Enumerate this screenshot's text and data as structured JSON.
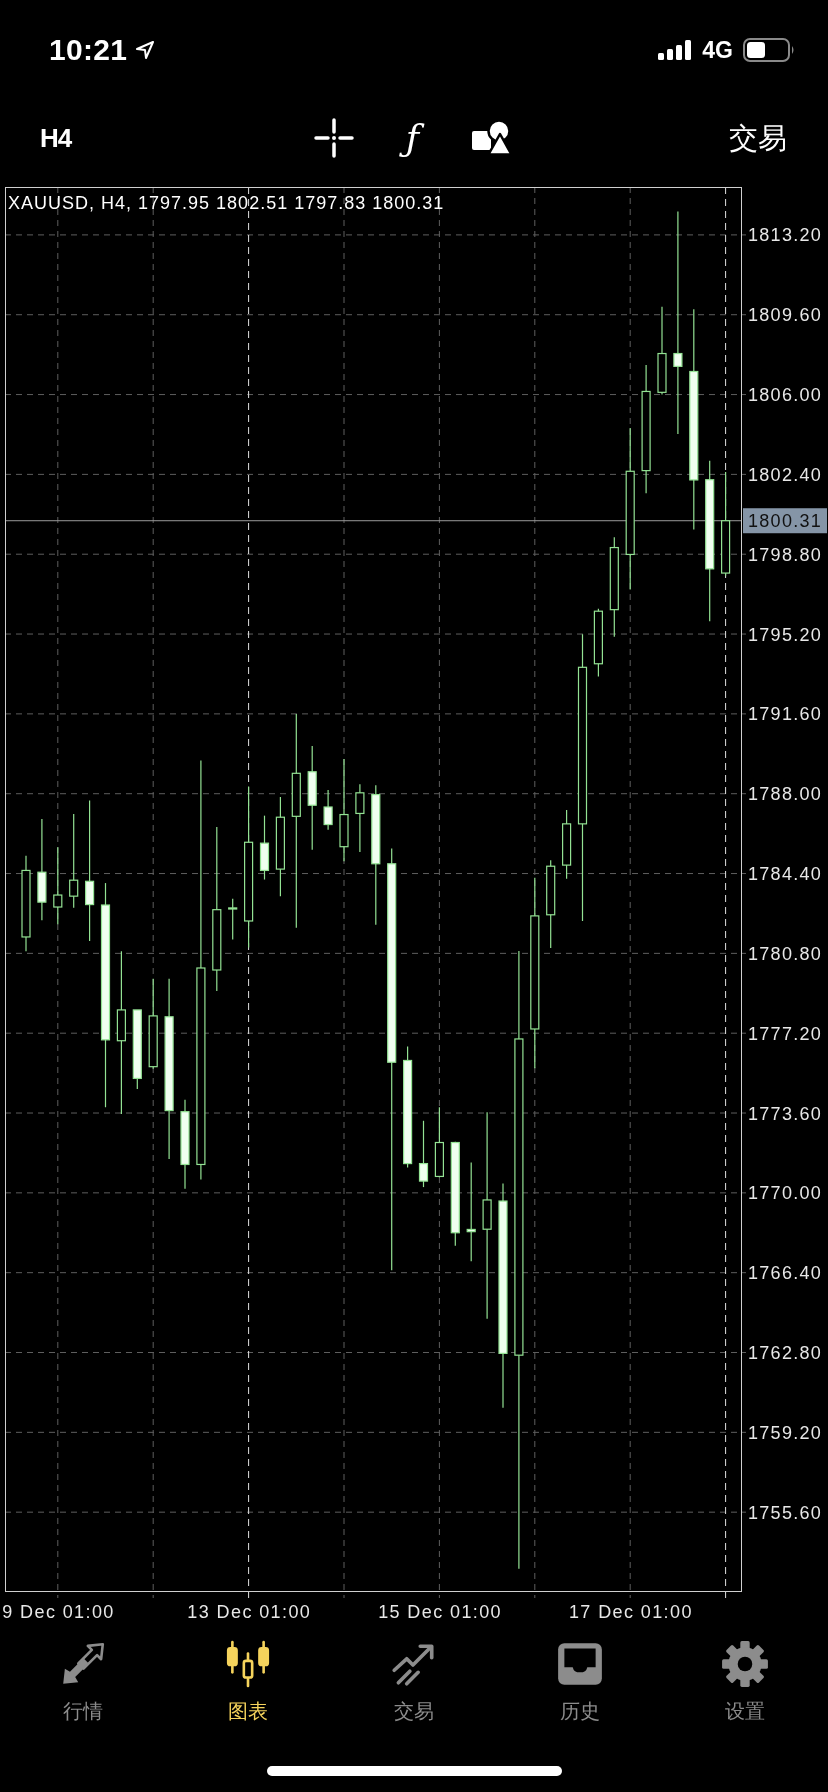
{
  "status_bar": {
    "time": "10:21",
    "network": "4G"
  },
  "toolbar": {
    "timeframe": "H4",
    "tools": [
      {
        "kind": "crosshair"
      },
      {
        "kind": "function",
        "glyph": "ƒ"
      },
      {
        "kind": "objects"
      }
    ],
    "trade": "交易"
  },
  "chart": {
    "chart_data": {
      "type": "candlestick",
      "title": "XAUUSD, H4, 1797.95 1802.51 1797.83 1800.31",
      "categories": [
        null,
        null,
        "9 Dec 01:00",
        null,
        null,
        null,
        null,
        null,
        null,
        null,
        null,
        null,
        null,
        null,
        "13 Dec 01:00",
        null,
        null,
        null,
        null,
        null,
        null,
        null,
        null,
        null,
        null,
        null,
        "15 Dec 01:00",
        null,
        null,
        null,
        null,
        null,
        null,
        null,
        null,
        null,
        null,
        null,
        "17 Dec 01:00",
        null,
        null,
        null,
        null,
        null,
        null
      ],
      "ohlc": [
        [
          1781.54,
          1785.2,
          1780.9,
          1784.54
        ],
        [
          1784.46,
          1786.86,
          1782.29,
          1783.11
        ],
        [
          1782.89,
          1785.58,
          1782.11,
          1783.43
        ],
        [
          1783.38,
          1787.09,
          1782.86,
          1784.1
        ],
        [
          1784.05,
          1787.69,
          1781.36,
          1783.0
        ],
        [
          1782.98,
          1783.97,
          1773.86,
          1776.9
        ],
        [
          1776.86,
          1780.9,
          1773.56,
          1778.25
        ],
        [
          1778.25,
          1778.25,
          1774.68,
          1775.16
        ],
        [
          1775.69,
          1779.66,
          1775.6,
          1777.98
        ],
        [
          1777.94,
          1779.66,
          1771.53,
          1773.71
        ],
        [
          1773.66,
          1774.2,
          1770.18,
          1771.28
        ],
        [
          1771.28,
          1789.5,
          1770.6,
          1780.14
        ],
        [
          1780.05,
          1786.5,
          1779.1,
          1782.77
        ],
        [
          1782.8,
          1783.26,
          1781.43,
          1782.85
        ],
        [
          1782.26,
          1788.33,
          1781.06,
          1785.81
        ],
        [
          1785.77,
          1787.01,
          1784.13,
          1784.54
        ],
        [
          1784.6,
          1787.85,
          1783.38,
          1786.94
        ],
        [
          1786.98,
          1791.6,
          1781.96,
          1788.92
        ],
        [
          1788.99,
          1790.15,
          1785.47,
          1787.48
        ],
        [
          1787.4,
          1788.17,
          1786.37,
          1786.61
        ],
        [
          1785.61,
          1789.57,
          1784.95,
          1787.06
        ],
        [
          1787.11,
          1788.43,
          1785.37,
          1788.04
        ],
        [
          1787.96,
          1788.38,
          1782.09,
          1784.84
        ],
        [
          1784.84,
          1785.53,
          1766.51,
          1775.89
        ],
        [
          1775.97,
          1776.6,
          1771.14,
          1771.32
        ],
        [
          1771.32,
          1773.25,
          1770.26,
          1770.53
        ],
        [
          1770.74,
          1773.86,
          1770.7,
          1772.27
        ],
        [
          1772.27,
          1772.3,
          1767.62,
          1768.2
        ],
        [
          1768.35,
          1771.37,
          1766.91,
          1768.25
        ],
        [
          1768.36,
          1773.64,
          1764.32,
          1769.68
        ],
        [
          1769.63,
          1770.42,
          1760.31,
          1762.76
        ],
        [
          1762.68,
          1780.91,
          1753.05,
          1776.94
        ],
        [
          1777.39,
          1784.21,
          1775.62,
          1782.49
        ],
        [
          1782.54,
          1785.0,
          1781.04,
          1784.73
        ],
        [
          1784.78,
          1787.26,
          1784.16,
          1786.64
        ],
        [
          1786.64,
          1795.19,
          1782.26,
          1793.7
        ],
        [
          1793.86,
          1796.34,
          1793.29,
          1796.23
        ],
        [
          1796.3,
          1799.56,
          1795.08,
          1799.1
        ],
        [
          1798.79,
          1804.49,
          1797.21,
          1802.54
        ],
        [
          1802.57,
          1807.33,
          1801.55,
          1806.14
        ],
        [
          1806.1,
          1809.96,
          1806.0,
          1807.85
        ],
        [
          1807.85,
          1814.25,
          1804.22,
          1807.27
        ],
        [
          1807.04,
          1809.85,
          1799.91,
          1802.15
        ],
        [
          1802.16,
          1803.02,
          1795.78,
          1798.14
        ],
        [
          1797.95,
          1802.51,
          1797.83,
          1800.31
        ]
      ],
      "ylim": [
        1752.0,
        1815.36
      ],
      "yticks": [
        {
          "value": 1813.2,
          "label": "1813.20"
        },
        {
          "value": 1809.6,
          "label": "1809.60"
        },
        {
          "value": 1806.0,
          "label": "1806.00"
        },
        {
          "value": 1802.4,
          "label": "1802.40"
        },
        {
          "value": 1798.8,
          "label": "1798.80"
        },
        {
          "value": 1795.2,
          "label": "1795.20"
        },
        {
          "value": 1791.6,
          "label": "1791.60"
        },
        {
          "value": 1788.0,
          "label": "1788.00"
        },
        {
          "value": 1784.4,
          "label": "1784.40"
        },
        {
          "value": 1780.8,
          "label": "1780.80"
        },
        {
          "value": 1777.2,
          "label": "1777.20"
        },
        {
          "value": 1773.6,
          "label": "1773.60"
        },
        {
          "value": 1770.0,
          "label": "1770.00"
        },
        {
          "value": 1766.4,
          "label": "1766.40"
        },
        {
          "value": 1762.8,
          "label": "1762.80"
        },
        {
          "value": 1759.2,
          "label": "1759.20"
        },
        {
          "value": 1755.6,
          "label": "1755.60"
        }
      ],
      "grid": true,
      "ref_lines": [
        {
          "axis": "y",
          "value": 1800.31,
          "label": "1800.31"
        }
      ]
    }
  },
  "tabs": [
    {
      "kind": "quotes",
      "label": "行情",
      "selected": false
    },
    {
      "kind": "chart",
      "label": "图表",
      "selected": true
    },
    {
      "kind": "trade",
      "label": "交易",
      "selected": false
    },
    {
      "kind": "history",
      "label": "历史",
      "selected": false
    },
    {
      "kind": "settings",
      "label": "设置",
      "selected": false
    }
  ]
}
